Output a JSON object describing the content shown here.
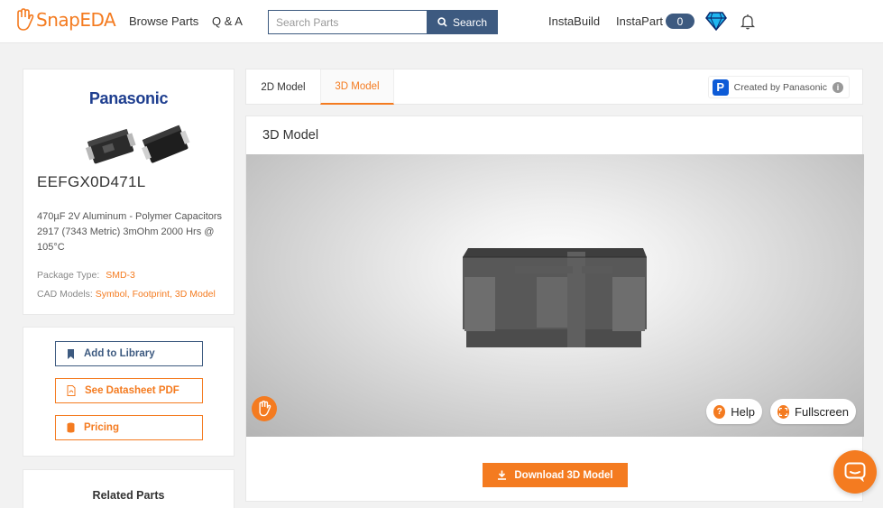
{
  "header": {
    "logo_text": "SnapEDA",
    "nav": {
      "browse": "Browse Parts",
      "qa": "Q & A"
    },
    "search": {
      "placeholder": "Search Parts",
      "button_label": "Search"
    },
    "instabuild": "InstaBuild",
    "instapart": "InstaPart",
    "instapart_count": "0"
  },
  "part": {
    "brand": "Panasonic",
    "number": "EEFGX0D471L",
    "description": "470µF 2V Aluminum - Polymer Capacitors 2917 (7343 Metric) 3mOhm 2000 Hrs @ 105°C",
    "package_label": "Package Type:",
    "package_value": "SMD-3",
    "cad_label": "CAD Models:",
    "cad_value": "Symbol, Footprint, 3D Model"
  },
  "actions": {
    "add_library": "Add to Library",
    "datasheet": "See Datasheet PDF",
    "pricing": "Pricing"
  },
  "related": {
    "title": "Related Parts"
  },
  "tabs": [
    {
      "label": "2D Model"
    },
    {
      "label": "3D Model",
      "active": true
    }
  ],
  "created_by": "Created by Panasonic",
  "model": {
    "title": "3D Model",
    "help": "Help",
    "fullscreen": "Fullscreen",
    "download": "Download 3D Model"
  },
  "colors": {
    "accent": "#f47b20",
    "navy": "#3d5a80",
    "brand_blue": "#1e3e8f"
  }
}
